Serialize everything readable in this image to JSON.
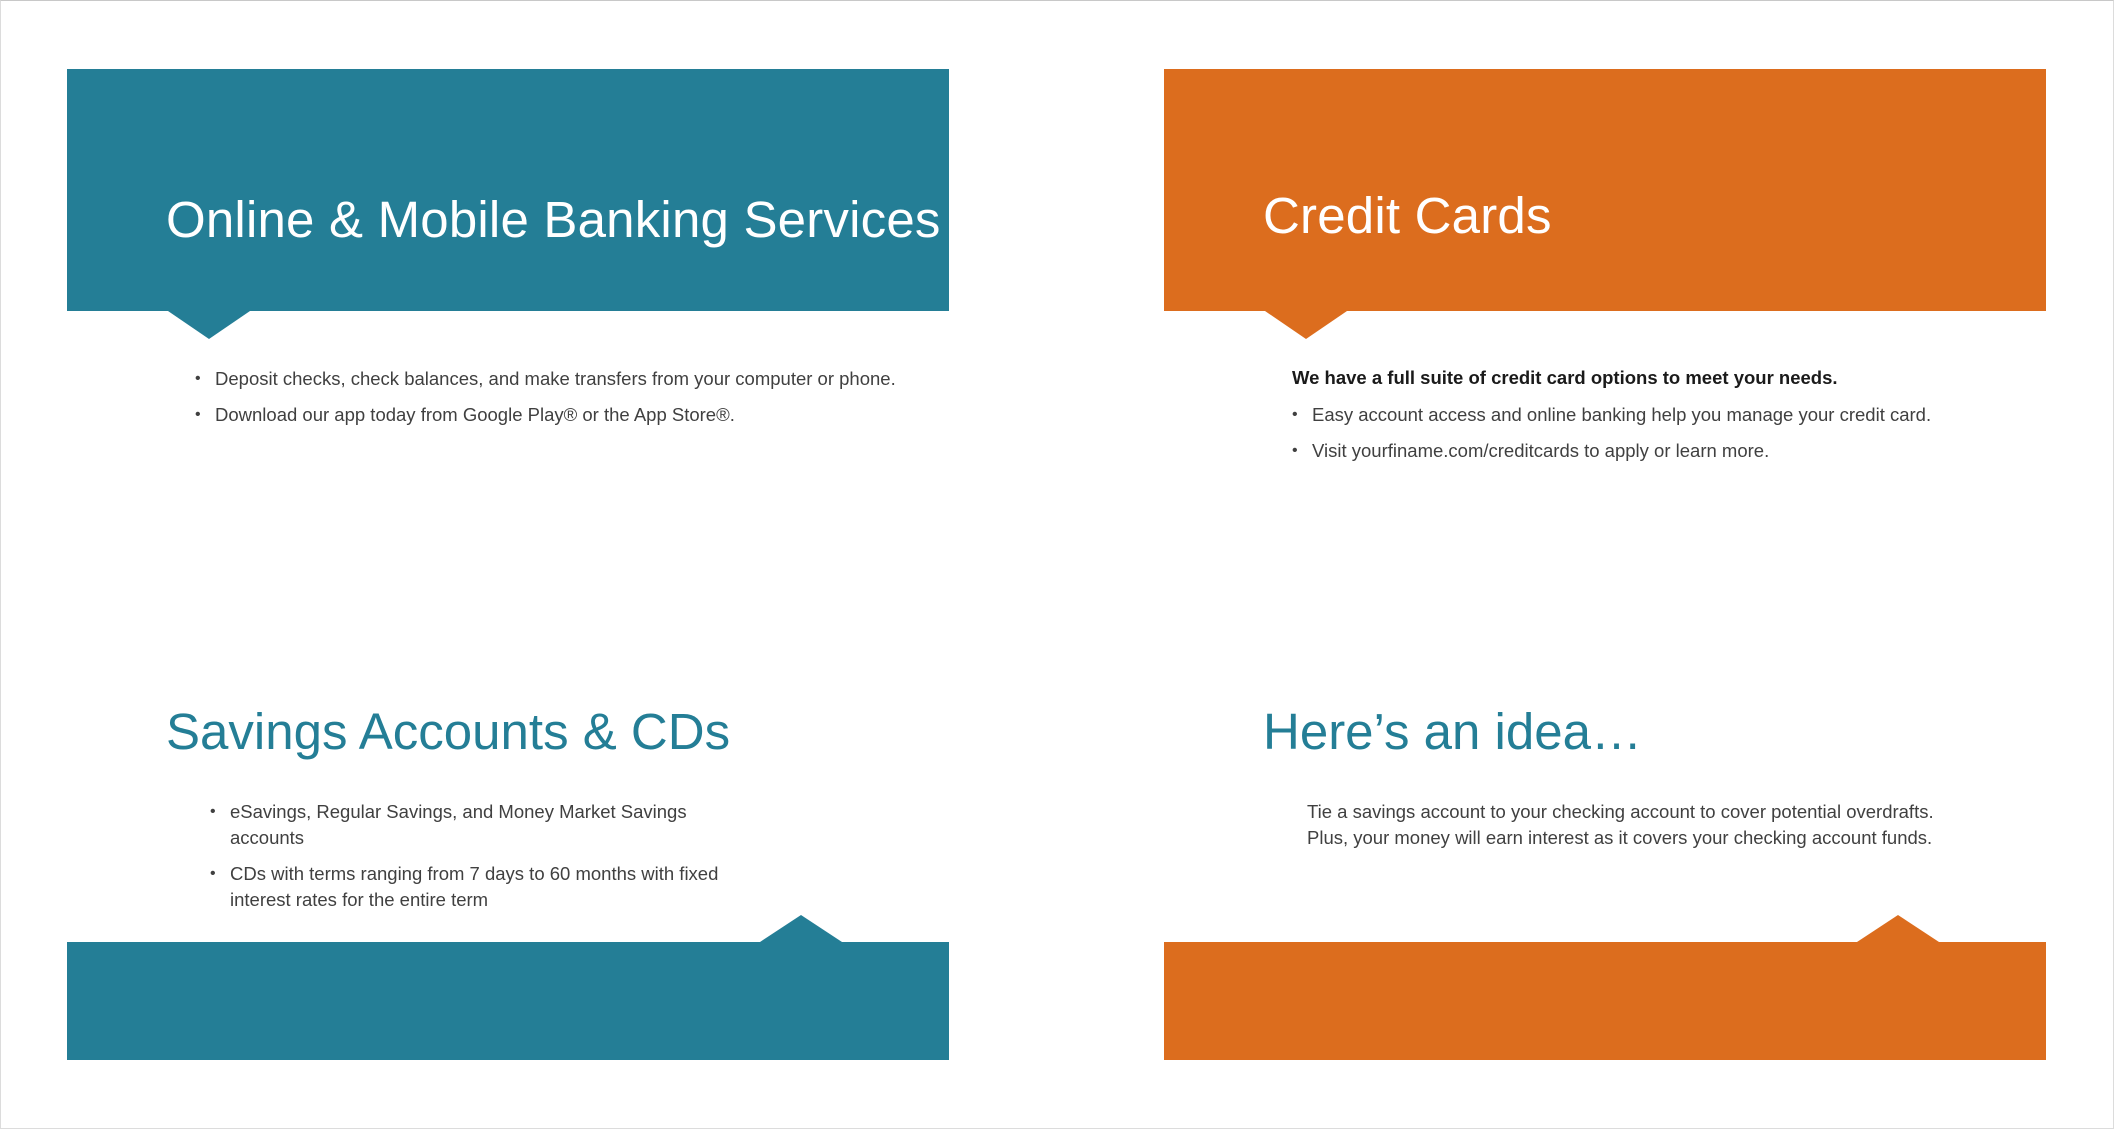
{
  "colors": {
    "teal": "#247e96",
    "orange": "#dc6d1e",
    "body_text": "#404040",
    "bold_text": "#1a1a1a",
    "background": "#ffffff"
  },
  "panels": {
    "online_banking": {
      "title": "Online & Mobile Banking Services",
      "bullets": [
        "Deposit checks, check balances, and make transfers from your computer or phone.",
        "Download our app today from Google Play® or the App Store®."
      ]
    },
    "credit_cards": {
      "title": "Credit Cards",
      "lead": "We have a full suite of credit card options to meet your needs.",
      "bullets": [
        "Easy account access and online banking help you manage your credit card.",
        "Visit yourfiname.com/creditcards to apply or learn more."
      ]
    },
    "savings": {
      "title": "Savings Accounts & CDs",
      "bullets": [
        "eSavings, Regular Savings, and Money Market Savings accounts",
        "CDs with terms ranging from 7 days to 60 months with fixed interest rates for the entire term"
      ]
    },
    "idea": {
      "title": "Here’s an idea…",
      "lines": [
        "Tie a savings account to your checking account to cover potential overdrafts.",
        "Plus, your money will earn interest as it covers your checking account funds."
      ]
    }
  }
}
